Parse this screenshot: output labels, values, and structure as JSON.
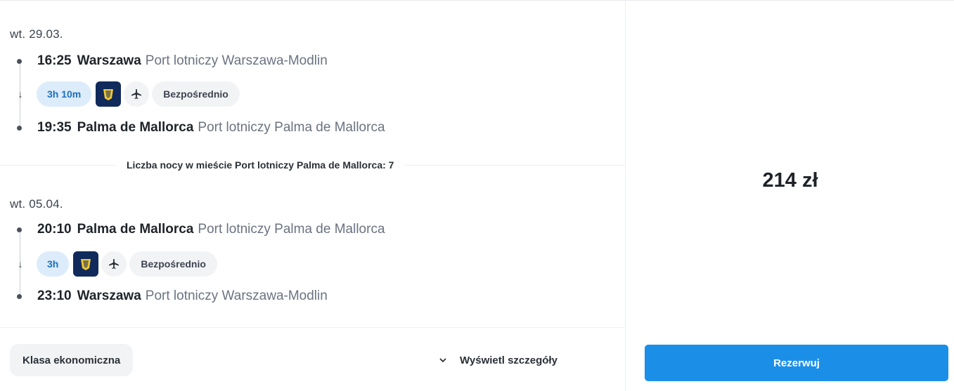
{
  "outbound": {
    "date": "wt. 29.03.",
    "departure": {
      "time": "16:25",
      "city": "Warszawa",
      "airport": "Port lotniczy Warszawa-Modlin"
    },
    "duration": "3h 10m",
    "airline_icon": "ryanair-harp-icon",
    "plane_icon": "airplane-icon",
    "stops": "Bezpośrednio",
    "arrival": {
      "time": "19:35",
      "city": "Palma de Mallorca",
      "airport": "Port lotniczy Palma de Mallorca"
    }
  },
  "stay": {
    "nights_label": "Liczba nocy w mieście Port lotniczy Palma de Mallorca: 7"
  },
  "inbound": {
    "date": "wt. 05.04.",
    "departure": {
      "time": "20:10",
      "city": "Palma de Mallorca",
      "airport": "Port lotniczy Palma de Mallorca"
    },
    "duration": "3h",
    "airline_icon": "ryanair-harp-icon",
    "plane_icon": "airplane-icon",
    "stops": "Bezpośrednio",
    "arrival": {
      "time": "23:10",
      "city": "Warszawa",
      "airport": "Port lotniczy Warszawa-Modlin"
    }
  },
  "footer": {
    "class_label": "Klasa ekonomiczna",
    "details_label": "Wyświetl szczegóły",
    "details_icon": "chevron-down-icon"
  },
  "booking": {
    "price": "214 zł",
    "book_label": "Rezerwuj"
  },
  "colors": {
    "accent": "#1b8fe8",
    "duration_pill_bg": "#dcecfa",
    "duration_pill_text": "#1d6fbf",
    "airline_logo_bg": "#102a5c"
  }
}
